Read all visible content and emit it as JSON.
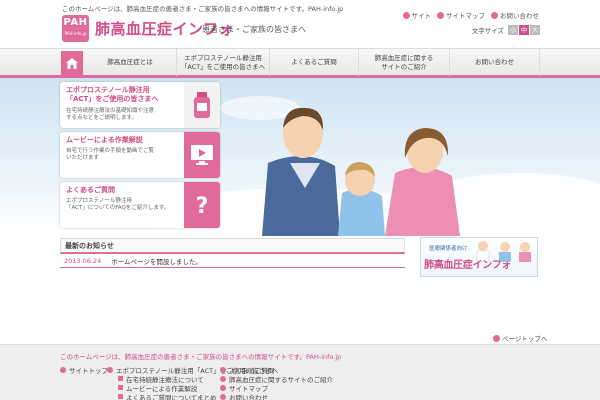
{
  "header": {
    "tagline": "このホームページは、肺高血圧症の患者さま・ご家族の皆さまへの情報サイトです。PAH-info.jp",
    "logo_main": "PAH",
    "logo_sub": "PAH-info.jp",
    "site_title": "肺高血圧症インフォ",
    "site_subtitle": "患者さま・ご家族の皆さまへ",
    "top_links": [
      "サイト",
      "サイトマップ",
      "お問い合わせ"
    ],
    "font_size_label": "文字サイズ",
    "font_sizes": [
      "小",
      "中",
      "大"
    ]
  },
  "nav": {
    "items": [
      "肺高血圧症とは",
      "エポプロステノール静注用\n「ACT」をご使用の皆さまへ",
      "よくあるご質問",
      "肺高血圧症に関する\nサイトのご紹介",
      "お問い合わせ"
    ]
  },
  "hero": {
    "banners": [
      {
        "title": "エポプロステノール静注用\n「ACT」をご使用の皆さまへ",
        "desc": "在宅持続静注療法の基礎知識や注意\nする点などをご説明します。",
        "icon": "medicine-bottle-icon"
      },
      {
        "title": "ムービーによる作業解説",
        "desc": "自宅で行う作業の手順を動画でご覧\nいただけます",
        "icon": "monitor-play-icon"
      },
      {
        "title": "よくあるご質問",
        "desc": "エポプロステノール静注用\n「ACT」についてのFAQをご紹介します。",
        "icon": "question-icon"
      }
    ]
  },
  "news": {
    "heading": "最新のお知らせ",
    "items": [
      {
        "date": "2013.06.24",
        "title": "ホームページを開設しました。"
      }
    ]
  },
  "side_banner": {
    "sub": "医療関係者向け",
    "title": "肺高血圧症インフォ"
  },
  "pagetop": "ページトップへ",
  "footer": {
    "tagline": "このホームページは、肺高血圧症の患者さま・ご家族の皆さまへの情報サイトです。PAH-info.jp",
    "col1": [
      "サイトトップ"
    ],
    "col2": [
      "エポプロステノール静注用「ACT」をご使用の皆さまへ",
      "在宅持続静注療法について",
      "ムービーによる作業解説",
      "よくあるご質問についてまとめ"
    ],
    "col3": [
      "よくあるご質問",
      "肺高血圧症に関するサイトのご紹介",
      "サイトマップ",
      "お問い合わせ"
    ]
  },
  "colors": {
    "accent": "#e06a9a",
    "accent_dark": "#d04d86",
    "sky": "#cfe3f2"
  }
}
